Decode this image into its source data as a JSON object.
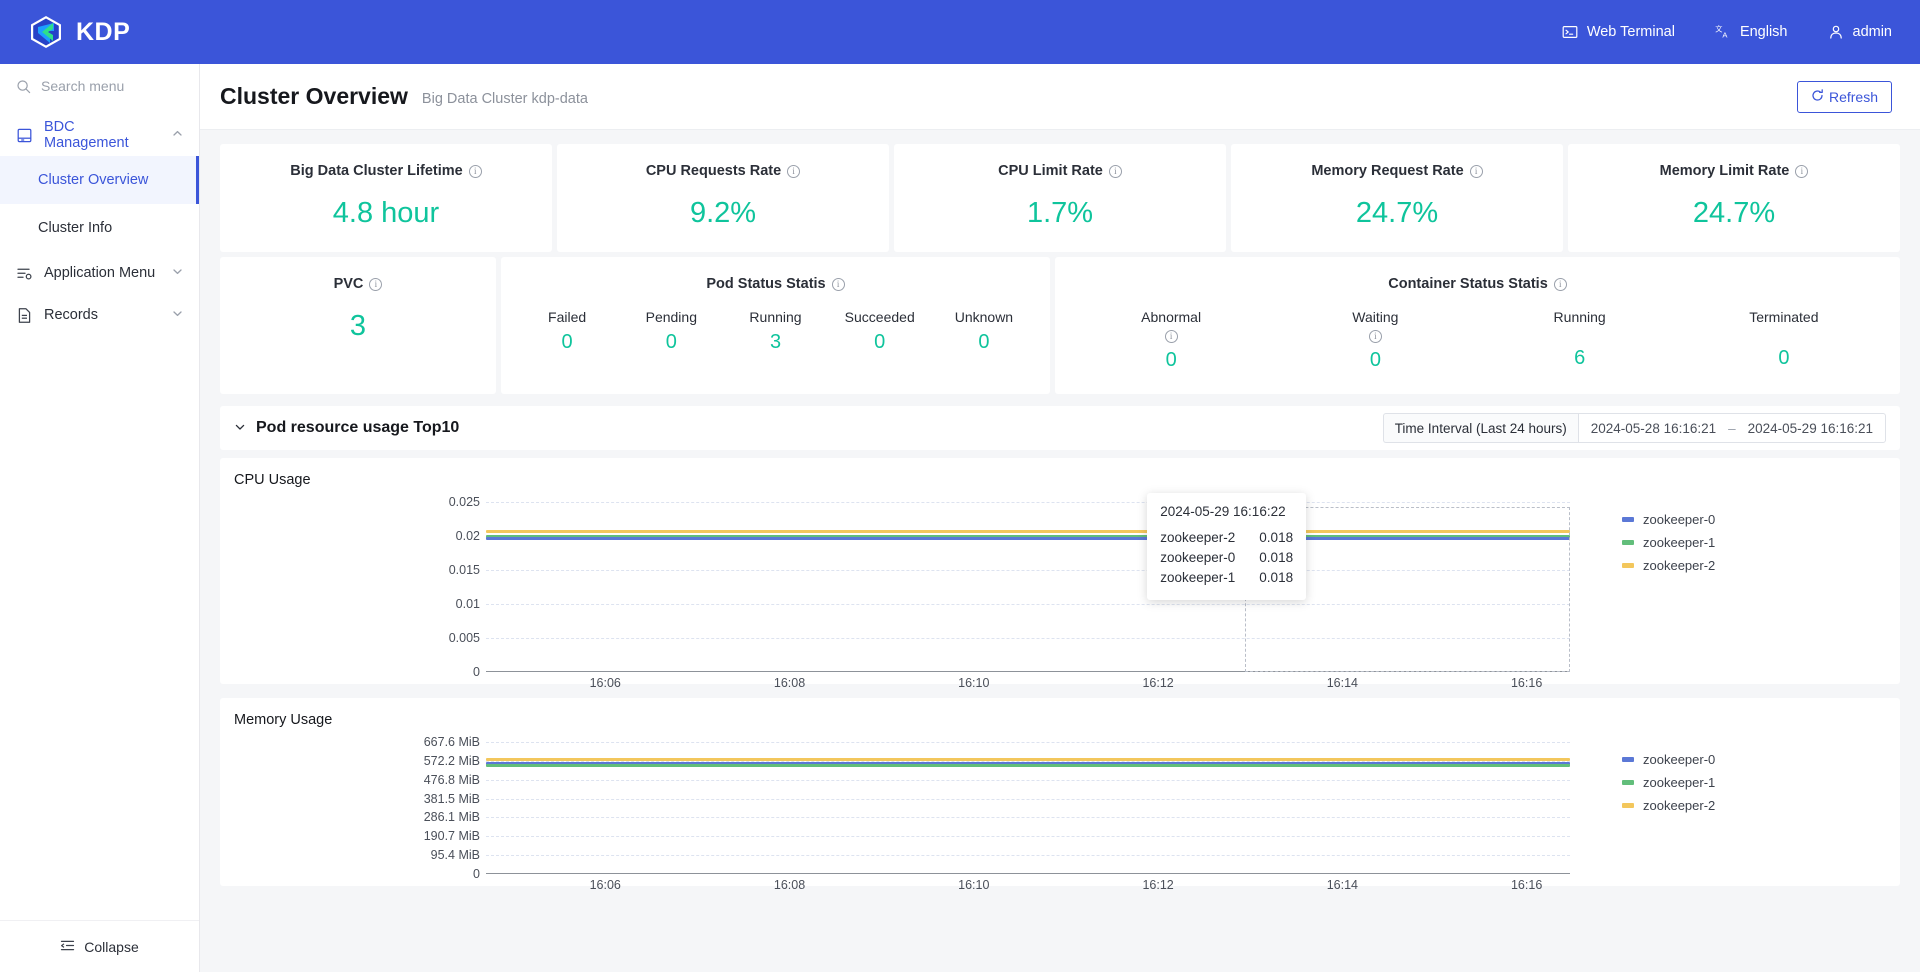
{
  "topbar": {
    "brand": "KDP",
    "logo_icon": "kdp-logo-icon",
    "items": [
      {
        "label": "Web Terminal",
        "icon": "terminal-icon"
      },
      {
        "label": "English",
        "icon": "language-icon"
      },
      {
        "label": "admin",
        "icon": "user-icon"
      }
    ]
  },
  "sidebar": {
    "search_placeholder": "Search menu",
    "search_icon": "search-icon",
    "groups": [
      {
        "label": "BDC Management",
        "icon": "book-icon",
        "expanded": true,
        "chevron": "chevron-up-icon"
      },
      {
        "label": "Application Menu",
        "icon": "list-settings-icon",
        "expanded": false,
        "chevron": "chevron-down-icon"
      },
      {
        "label": "Records",
        "icon": "document-icon",
        "expanded": false,
        "chevron": "chevron-down-icon"
      }
    ],
    "sub_items": [
      {
        "label": "Cluster Overview",
        "selected": true
      },
      {
        "label": "Cluster Info",
        "selected": false
      }
    ],
    "collapse_label": "Collapse",
    "collapse_icon": "collapse-icon"
  },
  "page": {
    "title": "Cluster Overview",
    "subtitle": "Big Data Cluster kdp-data",
    "refresh_label": "Refresh",
    "refresh_icon": "refresh-icon"
  },
  "stat_cards": [
    {
      "title": "Big Data Cluster Lifetime",
      "value": "4.8 hour",
      "info": true
    },
    {
      "title": "CPU Requests Rate",
      "value": "9.2%",
      "info": true
    },
    {
      "title": "CPU Limit Rate",
      "value": "1.7%",
      "info": true
    },
    {
      "title": "Memory Request Rate",
      "value": "24.7%",
      "info": true
    },
    {
      "title": "Memory Limit Rate",
      "value": "24.7%",
      "info": true
    }
  ],
  "pvc_card": {
    "title": "PVC",
    "value": "3",
    "info": true
  },
  "pod_status": {
    "title": "Pod Status Statis",
    "info": true,
    "cells": [
      {
        "label": "Failed",
        "value": "0",
        "info": false
      },
      {
        "label": "Pending",
        "value": "0",
        "info": false
      },
      {
        "label": "Running",
        "value": "3",
        "info": false
      },
      {
        "label": "Succeeded",
        "value": "0",
        "info": false
      },
      {
        "label": "Unknown",
        "value": "0",
        "info": false
      }
    ]
  },
  "container_status": {
    "title": "Container Status Statis",
    "info": true,
    "cells": [
      {
        "label": "Abnormal",
        "value": "0",
        "info": true
      },
      {
        "label": "Waiting",
        "value": "0",
        "info": true
      },
      {
        "label": "Running",
        "value": "6",
        "info": false
      },
      {
        "label": "Terminated",
        "value": "0",
        "info": false
      }
    ]
  },
  "section": {
    "title": "Pod resource usage Top10",
    "chevron": "chevron-down-icon",
    "time_label": "Time Interval (Last 24 hours)",
    "time_start": "2024-05-28 16:16:21",
    "time_dash": "–",
    "time_end": "2024-05-29 16:16:21"
  },
  "tooltip": {
    "time": "2024-05-29 16:16:22",
    "rows": [
      {
        "name": "zookeeper-2",
        "value": "0.018"
      },
      {
        "name": "zookeeper-0",
        "value": "0.018"
      },
      {
        "name": "zookeeper-1",
        "value": "0.018"
      }
    ]
  },
  "colors": {
    "brand_blue": "#3B55D9",
    "accent_green": "#0FC49C",
    "series_0": "#5B78D6",
    "series_1": "#62BE7B",
    "series_2": "#F3C75C"
  },
  "chart_data": [
    {
      "type": "line",
      "title": "CPU Usage",
      "xlabel": "",
      "ylabel": "",
      "ylim": [
        0,
        0.025
      ],
      "yticks": [
        "0.025",
        "0.02",
        "0.015",
        "0.01",
        "0.005",
        "0"
      ],
      "ytick_values": [
        0.025,
        0.02,
        0.015,
        0.01,
        0.005,
        0
      ],
      "xticks": [
        "16:06",
        "16:08",
        "16:10",
        "16:12",
        "16:14",
        "16:16"
      ],
      "grid": true,
      "legend_position": "right",
      "series": [
        {
          "name": "zookeeper-0",
          "color": "#5B78D6",
          "values": [
            0.0201,
            0.0201,
            0.02,
            0.02,
            0.02,
            0.02
          ]
        },
        {
          "name": "zookeeper-1",
          "color": "#62BE7B",
          "values": [
            0.0202,
            0.0203,
            0.0203,
            0.0203,
            0.0203,
            0.0202
          ]
        },
        {
          "name": "zookeeper-2",
          "color": "#F3C75C",
          "values": [
            0.0213,
            0.0212,
            0.0212,
            0.0211,
            0.0211,
            0.021
          ]
        }
      ]
    },
    {
      "type": "line",
      "title": "Memory Usage",
      "xlabel": "",
      "ylabel": "",
      "ylim": [
        0,
        667.6
      ],
      "yticks": [
        "667.6 MiB",
        "572.2 MiB",
        "476.8 MiB",
        "381.5 MiB",
        "286.1 MiB",
        "190.7 MiB",
        "95.4 MiB",
        "0"
      ],
      "ytick_values": [
        667.6,
        572.2,
        476.8,
        381.5,
        286.1,
        190.7,
        95.4,
        0
      ],
      "xticks": [
        "16:06",
        "16:08",
        "16:10",
        "16:12",
        "16:14",
        "16:16"
      ],
      "grid": true,
      "legend_position": "right",
      "series": [
        {
          "name": "zookeeper-0",
          "color": "#5B78D6",
          "values": [
            560,
            561,
            562,
            562,
            563,
            564
          ]
        },
        {
          "name": "zookeeper-1",
          "color": "#62BE7B",
          "values": [
            556,
            557,
            557,
            558,
            558,
            559
          ]
        },
        {
          "name": "zookeeper-2",
          "color": "#F3C75C",
          "values": [
            581,
            582,
            582,
            583,
            583,
            584
          ]
        }
      ]
    }
  ]
}
